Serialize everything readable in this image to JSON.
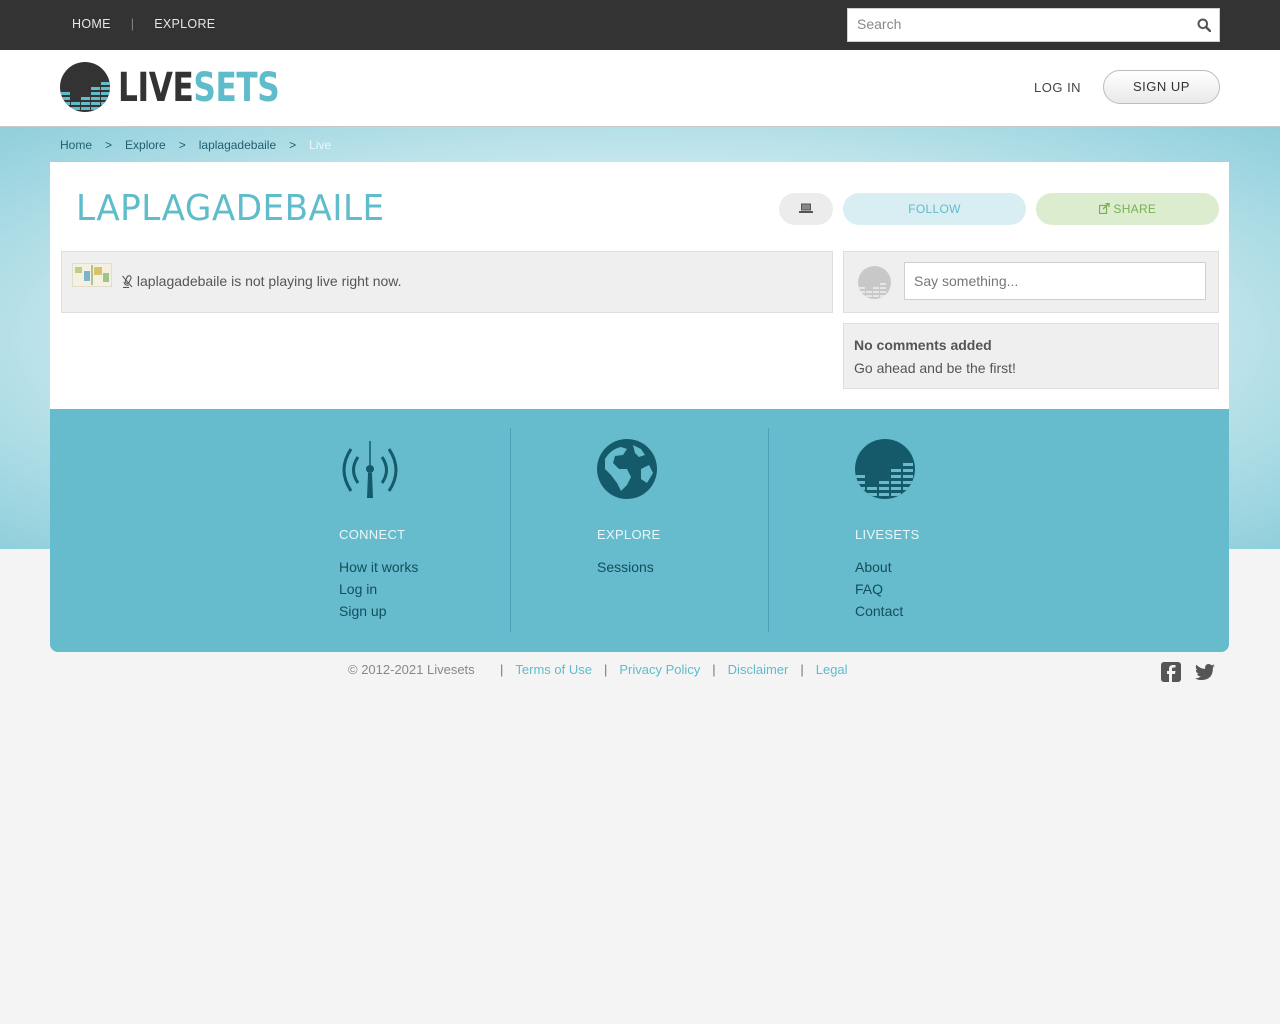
{
  "topnav": {
    "home": "HOME",
    "separator": "|",
    "explore": "EXPLORE"
  },
  "search": {
    "placeholder": "Search",
    "value": ""
  },
  "header": {
    "logo_part1": "LIVE",
    "logo_part2": "SETS",
    "login": "LOG IN",
    "signup": "SIGN UP"
  },
  "breadcrumb": {
    "separator": ">",
    "items": [
      "Home",
      "Explore",
      "laplagadebaile",
      "Live"
    ]
  },
  "profile": {
    "title": "LAPLAGADEBAILE",
    "follow": "FOLLOW",
    "share": "SHARE"
  },
  "live": {
    "status": "laplagadebaile is not playing live right now."
  },
  "comments": {
    "placeholder": "Say something...",
    "empty_title": "No comments added",
    "empty_sub": "Go ahead and be the first!"
  },
  "footer": {
    "columns": [
      {
        "title": "CONNECT",
        "links": [
          "How it works",
          "Log in",
          "Sign up"
        ]
      },
      {
        "title": "EXPLORE",
        "links": [
          "Sessions"
        ]
      },
      {
        "title": "LIVESETS",
        "links": [
          "About",
          "FAQ",
          "Contact"
        ]
      }
    ],
    "copyright": "© 2012-2021 Livesets",
    "separator": "|",
    "legal_links": [
      "Terms of Use",
      "Privacy Policy",
      "Disclaimer",
      "Legal"
    ]
  },
  "colors": {
    "accent": "#5fbccb",
    "footer_bg": "#66bccd",
    "topbar_bg": "#333333",
    "share_green": "#7ab050"
  },
  "icons": {
    "search": "search-icon",
    "device": "laptop-icon",
    "share": "share-icon",
    "live": "microphone-icon",
    "connect": "broadcast-icon",
    "explore": "globe-icon",
    "livesets": "livesets-logo-icon",
    "facebook": "facebook-icon",
    "twitter": "twitter-icon"
  }
}
